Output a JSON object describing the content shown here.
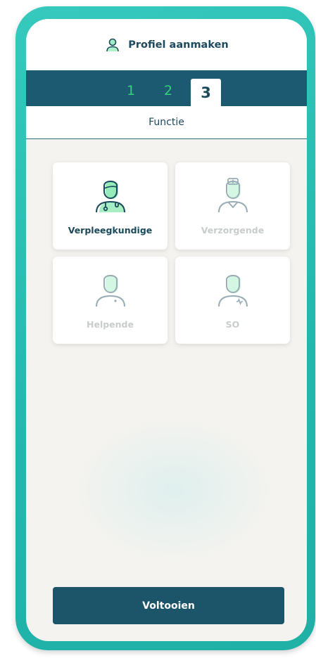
{
  "header": {
    "title": "Profiel aanmaken",
    "icon": "user-icon"
  },
  "steps": {
    "step1": "1",
    "step2": "2",
    "step3": "3",
    "active_step": 3
  },
  "subheader": {
    "title": "Functie"
  },
  "roles": [
    {
      "label": "Verpleegkundige",
      "icon": "nurse-stethoscope-icon",
      "selected": true
    },
    {
      "label": "Verzorgende",
      "icon": "caregiver-cap-icon",
      "selected": false
    },
    {
      "label": "Helpende",
      "icon": "helper-icon",
      "selected": false
    },
    {
      "label": "SO",
      "icon": "so-icon",
      "selected": false
    }
  ],
  "cta": {
    "label": "Voltooien"
  },
  "colors": {
    "frame": "#22b7ad",
    "primary": "#1b5a70",
    "accent_green": "#33d17a",
    "text_dark": "#1b4a5c",
    "text_disabled": "#c8cccd"
  }
}
